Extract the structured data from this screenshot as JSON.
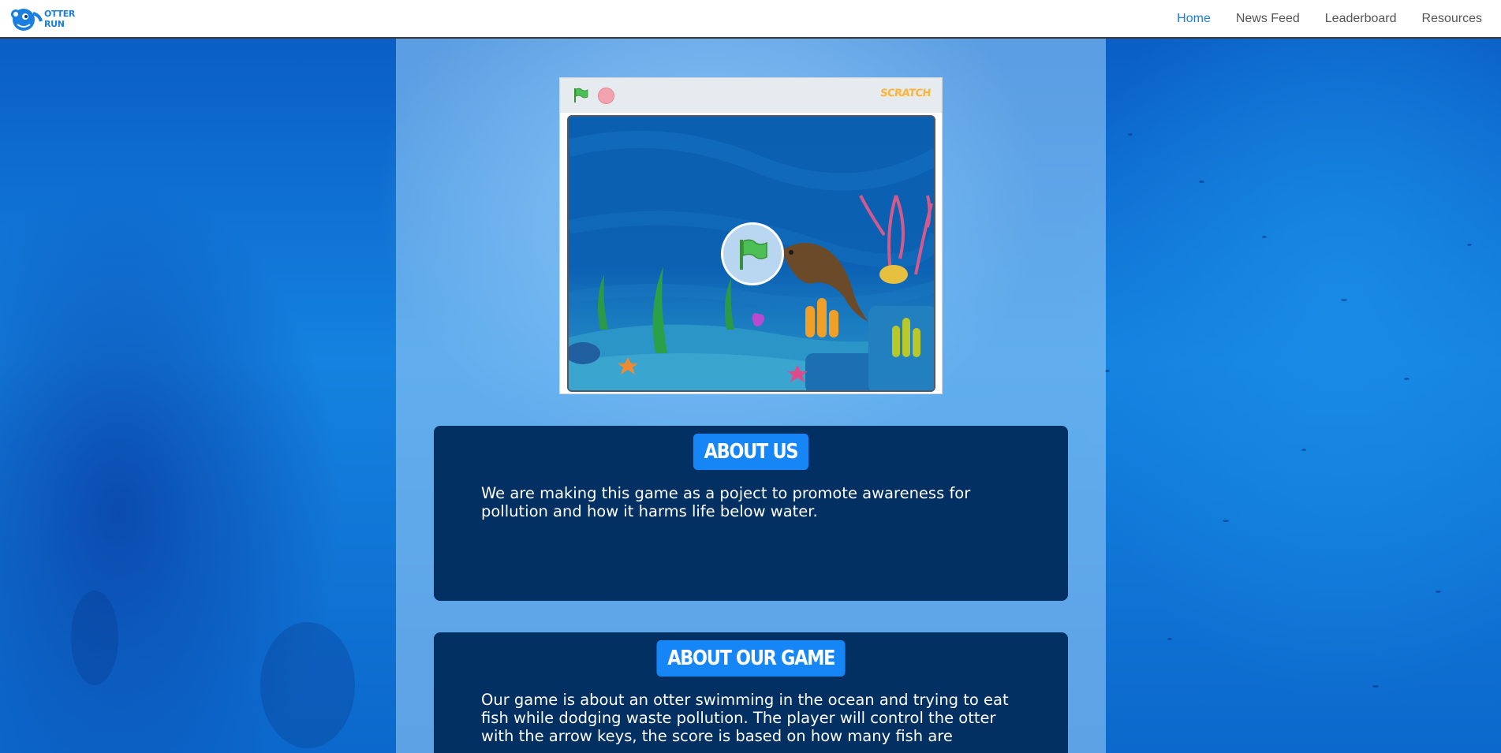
{
  "nav": {
    "logo_line1": "OTTER",
    "logo_line2": "RUN",
    "links": [
      {
        "label": "Home",
        "active": true
      },
      {
        "label": "News Feed",
        "active": false
      },
      {
        "label": "Leaderboard",
        "active": false
      },
      {
        "label": "Resources",
        "active": false
      }
    ]
  },
  "player": {
    "logo": "SCRATCH",
    "icons": [
      "green-flag-icon",
      "stop-icon"
    ]
  },
  "about_us": {
    "title": "ABOUT US",
    "text": "We are making this game as a poject to promote awareness for pollution and how it harms life below water."
  },
  "about_game": {
    "title": "ABOUT OUR GAME",
    "text": "Our game is about an otter swimming in the ocean and trying to eat fish while dodging waste pollution. The player will control the otter with the arrow keys, the score is based on how many fish are"
  },
  "colors": {
    "accent": "#1a7fe0",
    "card_bg": "#023062",
    "title_bg": "#1686f7"
  }
}
